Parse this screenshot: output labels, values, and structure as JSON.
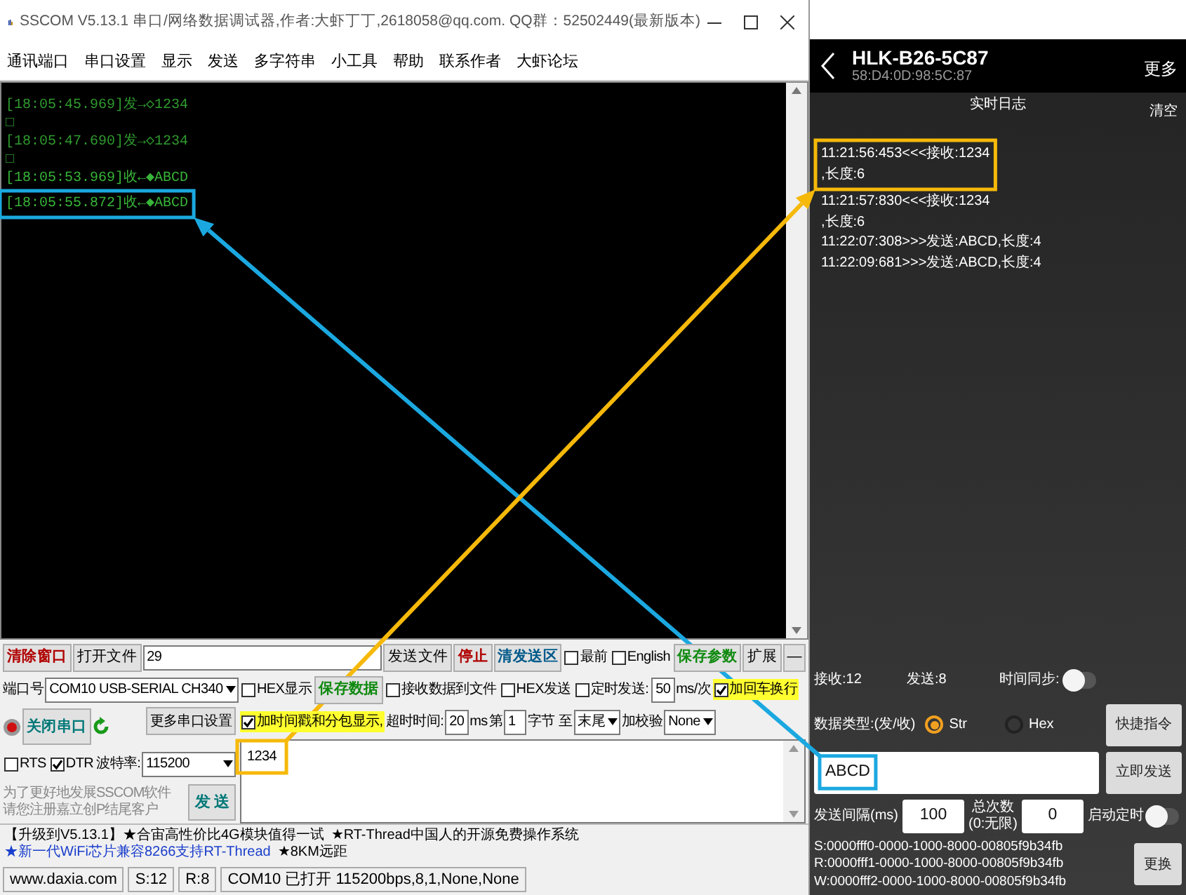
{
  "window": {
    "title": "SSCOM V5.13.1 串口/网络数据调试器,作者:大虾丁丁,2618058@qq.com. QQ群：52502449(最新版本)"
  },
  "menu": [
    "通讯端口",
    "串口设置",
    "显示",
    "发送",
    "多字符串",
    "小工具",
    "帮助",
    "联系作者",
    "大虾论坛"
  ],
  "terminal": {
    "lines": [
      {
        "kind": "send",
        "text": "[18:05:45.969]发→◇1234"
      },
      {
        "kind": "blank",
        "text": "□"
      },
      {
        "kind": "send",
        "text": "[18:05:47.690]发→◇1234"
      },
      {
        "kind": "blank",
        "text": "□"
      },
      {
        "kind": "recv",
        "text": "[18:05:53.969]收←◆ABCD"
      },
      {
        "kind": "recv",
        "text": "[18:05:55.872]收←◆ABCD",
        "highlight": {
          "color": "#1ba8e0",
          "arrow_head": true
        }
      }
    ]
  },
  "controls": {
    "top_row": [
      {
        "kind": "button",
        "color": "#b00000",
        "label": "清除窗口"
      },
      {
        "kind": "button",
        "color": "#000000",
        "label": "打开文件"
      },
      {
        "kind": "path_field",
        "value": "29"
      },
      {
        "kind": "button",
        "color": "#000000",
        "label": "发送文件"
      },
      {
        "kind": "button",
        "color": "#b00000",
        "label": "停止"
      },
      {
        "kind": "button",
        "color": "#005a8a",
        "label": "清发送区"
      },
      {
        "kind": "checkbox",
        "label": "最前",
        "checked": false
      },
      {
        "kind": "checkbox",
        "label": "English",
        "checked": false
      },
      {
        "kind": "button",
        "color": "#108a10",
        "label": "保存参数"
      },
      {
        "kind": "button",
        "color": "#000000",
        "label": "扩展"
      },
      {
        "kind": "button",
        "color": "#000000",
        "label": "—"
      }
    ],
    "port": {
      "label": "端口号",
      "value": "COM10 USB-SERIAL CH340"
    },
    "open_button": "关闭串口",
    "more_settings_button": "更多串口设置",
    "rts": {
      "label": "RTS",
      "checked": false
    },
    "dtr": {
      "label": "DTR",
      "checked": true
    },
    "baud": {
      "label": "波特率:",
      "value": "115200"
    },
    "right_rows": [
      [
        {
          "kind": "checkbox",
          "label": "HEX显示",
          "checked": false
        },
        {
          "kind": "button",
          "color": "#108a10",
          "label": "保存数据"
        },
        {
          "kind": "checkbox",
          "label": "接收数据到文件",
          "checked": false
        },
        {
          "kind": "checkbox",
          "label": "HEX发送",
          "checked": false
        },
        {
          "kind": "checkbox",
          "label": "定时发送:",
          "checked": false
        },
        {
          "kind": "field",
          "value": "50"
        },
        {
          "kind": "label",
          "text": "ms/次"
        },
        {
          "kind": "checkbox",
          "label": "加回车换行",
          "checked": true
        }
      ],
      [
        {
          "kind": "checkbox",
          "label": "加时间戳和分包显示,",
          "checked": true
        },
        {
          "kind": "label",
          "text": "超时时间:"
        },
        {
          "kind": "field",
          "value": "20"
        },
        {
          "kind": "label",
          "text": "ms"
        },
        {
          "kind": "label",
          "text": "第"
        },
        {
          "kind": "field",
          "value": "1"
        },
        {
          "kind": "label",
          "text": "字节 至"
        },
        {
          "kind": "select",
          "value": "末尾"
        },
        {
          "kind": "label",
          "text": "加校验"
        },
        {
          "kind": "select",
          "value": "None"
        }
      ]
    ],
    "send_box": {
      "value": "1234",
      "highlight": {
        "color": "#f6b90a",
        "arrow_head": false
      }
    },
    "notice": [
      "为了更好地发展SSCOM软件",
      "请您注册嘉立创P结尾客户"
    ],
    "send_button": "发 送"
  },
  "marquee": [
    {
      "text": "【升级到V5.13.1】★合宙高性价比4G模块值得一试",
      "emphasis": false
    },
    {
      "text": "★RT-Thread中国人的开源免费操作系统",
      "emphasis": false
    },
    {
      "text": "★新一代WiFi芯片兼容8266支持RT-Thread",
      "emphasis": true
    },
    {
      "text": "★8KM远距",
      "emphasis": false
    }
  ],
  "status_bar": [
    "www.daxia.com",
    "S:12",
    "R:8",
    "COM10 已打开  115200bps,8,1,None,None"
  ],
  "phone": {
    "title": "HLK-B26-5C87",
    "address": "58:D4:0D:98:5C:87",
    "more_button": "更多",
    "log_title": "实时日志",
    "clear_button": "清空",
    "log": [
      {
        "text": "11:21:56:453<<<接收:1234",
        "highlight": {
          "color": "#f6b90a",
          "arrow_head": true
        }
      },
      {
        "text": ",长度:6",
        "highlight": {
          "color": "#f6b90a",
          "arrow_head": true
        }
      },
      {
        "text": "11:21:57:830<<<接收:1234"
      },
      {
        "text": ",长度:6"
      },
      {
        "text": "11:22:07:308>>>发送:ABCD,长度:4"
      },
      {
        "text": "11:22:09:681>>>发送:ABCD,长度:4"
      }
    ],
    "received": "接收:12",
    "sent": "发送:8",
    "time_sync": {
      "label": "时间同步:",
      "on": false
    },
    "data_type": {
      "label": "数据类型:(发/收)",
      "options": [
        {
          "label": "Str",
          "selected": true
        },
        {
          "label": "Hex",
          "selected": false
        }
      ]
    },
    "shortcut_button": "快捷指令",
    "send_input": {
      "value": "ABCD",
      "highlight": {
        "color": "#1ba8e0",
        "arrow_head": false
      }
    },
    "send_now_button": "立即发送",
    "interval": {
      "label": "发送间隔(ms)",
      "value": "100"
    },
    "count": {
      "label": [
        "总次数",
        "(0:无限)"
      ],
      "value": "0"
    },
    "timer": {
      "label": "启动定时",
      "on": false
    },
    "uuids": [
      "S:0000fff0-0000-1000-8000-00805f9b34fb",
      "R:0000fff1-0000-1000-8000-00805f9b34fb",
      "W:0000fff2-0000-1000-8000-00805f9b34fb"
    ],
    "change_button": "更换"
  }
}
